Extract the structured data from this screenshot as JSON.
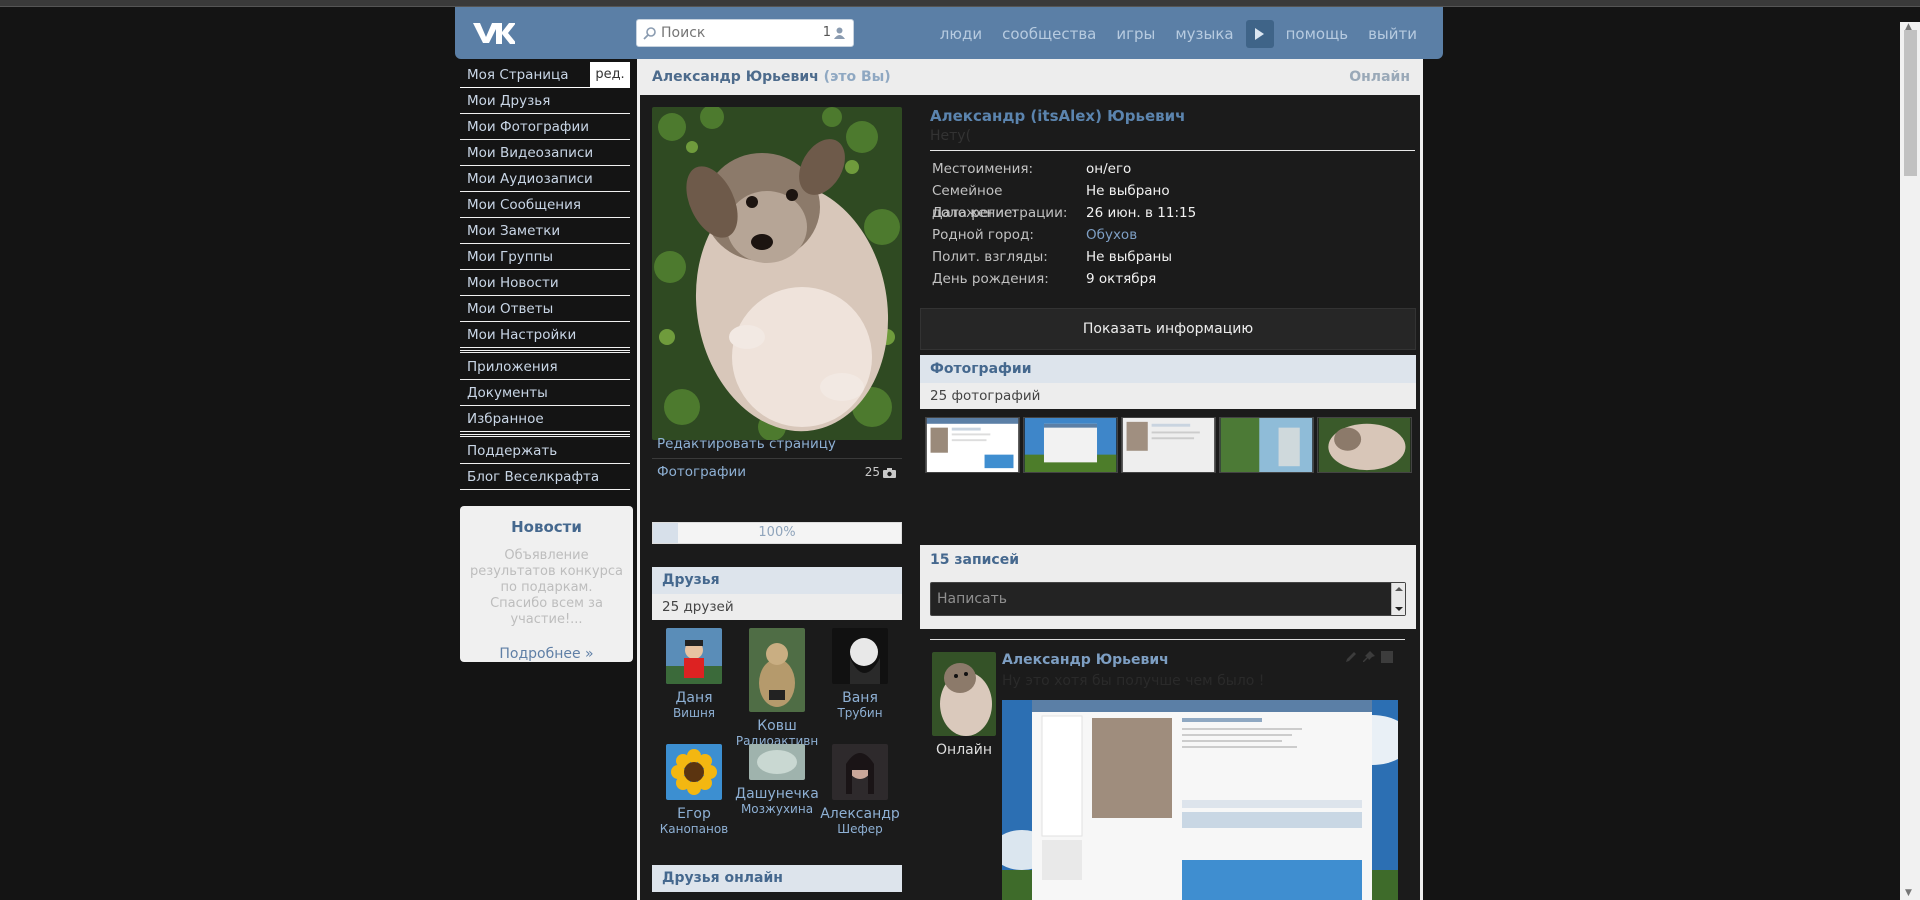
{
  "header": {
    "logo": "VK",
    "search_placeholder": "Поиск",
    "search_count": "1",
    "nav": [
      "люди",
      "сообщества",
      "игры",
      "музыка",
      "помощь",
      "выйти"
    ]
  },
  "left_menu": {
    "edit_label": "ред.",
    "group1": [
      "Моя Страница",
      "Мои Друзья",
      "Мои Фотографии",
      "Мои Видеозаписи",
      "Мои Аудиозаписи",
      "Мои Сообщения",
      "Мои Заметки",
      "Мои Группы",
      "Мои Новости",
      "Мои Ответы",
      "Мои Настройки"
    ],
    "group2": [
      "Приложения",
      "Документы",
      "Избранное"
    ],
    "group3": [
      "Поддержать",
      "Блог Веселкрафта"
    ]
  },
  "news": {
    "title": "Новости",
    "text": "Объявление результатов конкурса по подаркам. Спасибо всем за участие!...",
    "more": "Подробнее »"
  },
  "page": {
    "owner_name": "Александр Юрьевич",
    "owner_note": "(это Вы)",
    "online": "Онлайн"
  },
  "profile": {
    "full_name": "Александр (itsAlex) Юрьевич",
    "status": "Нету(",
    "info": [
      {
        "key": "Местоимения:",
        "value": "он/его"
      },
      {
        "key": "Семейное положение:",
        "value": "Не выбрано"
      },
      {
        "key": "Дата регистрации:",
        "value": "26 июн. в 11:15"
      },
      {
        "key": "Родной город:",
        "value": "Обухов"
      },
      {
        "key": "Полит. взгляды:",
        "value": "Не выбраны"
      },
      {
        "key": "День рождения:",
        "value": "9 октября"
      }
    ],
    "show_info": "Показать информацию"
  },
  "left_col": {
    "edit_page": "Редактировать страницу",
    "photos_label": "Фотографии",
    "photos_count": "25",
    "progress_label": "100%",
    "progress_value": 0.1,
    "friends_title": "Друзья",
    "friends_count": "25 друзей",
    "friends_online_title": "Друзья онлайн",
    "friends": [
      {
        "first": "Даня",
        "last": "Вишня"
      },
      {
        "first": "Ковш",
        "last": "Радиоактивный"
      },
      {
        "first": "Ваня",
        "last": "Трубин"
      },
      {
        "first": "Егор",
        "last": "Канопанов"
      },
      {
        "first": "Дашунечка",
        "last": "Мозжухина"
      },
      {
        "first": "Александр",
        "last": "Шефер"
      }
    ]
  },
  "photos_box": {
    "title": "Фотографии",
    "count": "25 фотографий"
  },
  "wall": {
    "title": "15 записей",
    "placeholder": "Написать"
  },
  "post": {
    "author": "Александр Юрьевич",
    "online": "Онлайн",
    "text": "Ну это хотя бы получше чем было !"
  },
  "colors": {
    "header": "#5b7fa6",
    "link": "#45688e",
    "background": "#141414"
  }
}
